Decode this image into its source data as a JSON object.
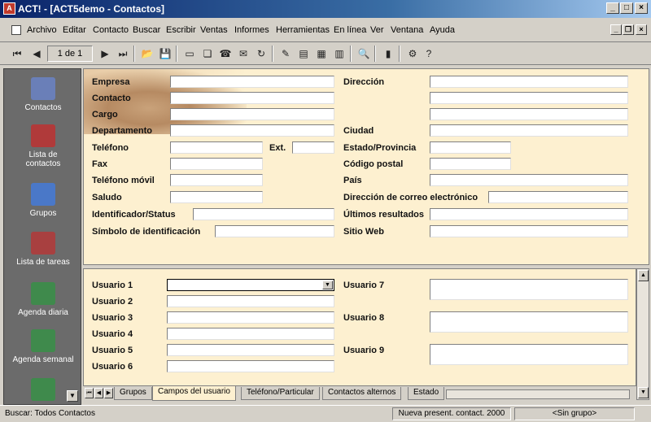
{
  "window": {
    "title": "ACT! - [ACT5demo - Contactos]",
    "app_icon": "act-app-icon"
  },
  "menu": [
    "Archivo",
    "Editar",
    "Contacto",
    "Buscar",
    "Escribir",
    "Ventas",
    "Informes",
    "Herramientas",
    "En línea",
    "Ver",
    "Ventana",
    "Ayuda"
  ],
  "toolbar": {
    "record_position": "1 de 1"
  },
  "sidebar": [
    {
      "label": "Contactos",
      "icon": "contacts-icon",
      "color": "#6a7fb8"
    },
    {
      "label": "Lista de\ncontactos",
      "icon": "contact-list-icon",
      "color": "#b03a3a"
    },
    {
      "label": "Grupos",
      "icon": "groups-icon",
      "color": "#4a78c8"
    },
    {
      "label": "Lista de tareas",
      "icon": "task-list-icon",
      "color": "#a84040"
    },
    {
      "label": "Agenda diaria",
      "icon": "daily-calendar-icon",
      "color": "#3f8a4c"
    },
    {
      "label": "Agenda semanal",
      "icon": "weekly-calendar-icon",
      "color": "#3f8a4c"
    },
    {
      "label": "",
      "icon": "monthly-calendar-icon",
      "color": "#3f8a4c"
    }
  ],
  "form": {
    "left": {
      "empresa": "Empresa",
      "contacto": "Contacto",
      "cargo": "Cargo",
      "departamento": "Departamento",
      "telefono": "Teléfono",
      "ext": "Ext.",
      "fax": "Fax",
      "movil": "Teléfono móvil",
      "saludo": "Saludo",
      "identificador": "Identificador/Status",
      "simbolo": "Símbolo de identificación"
    },
    "right": {
      "direccion": "Dirección",
      "ciudad": "Ciudad",
      "estado": "Estado/Provincia",
      "codigo": "Código postal",
      "pais": "País",
      "correo": "Dirección de correo electrónico",
      "ultimos": "Últimos resultados",
      "web": "Sitio Web"
    }
  },
  "user_fields": {
    "u1": "Usuario 1",
    "u2": "Usuario 2",
    "u3": "Usuario 3",
    "u4": "Usuario 4",
    "u5": "Usuario 5",
    "u6": "Usuario 6",
    "u7": "Usuario 7",
    "u8": "Usuario 8",
    "u9": "Usuario 9"
  },
  "tabs": [
    "Grupos",
    "Campos del usuario",
    "Teléfono/Particular",
    "Contactos alternos",
    "Estado"
  ],
  "active_tab": "Campos del usuario",
  "status": {
    "lookup": "Buscar: Todos Contactos",
    "count": "Nueva present. contact. 2000",
    "group": "<Sin grupo>"
  },
  "colors": {
    "form_bg": "#fdf0d0",
    "titlebar": "#0a246a",
    "sidebar_bg": "#6b6b6b"
  }
}
